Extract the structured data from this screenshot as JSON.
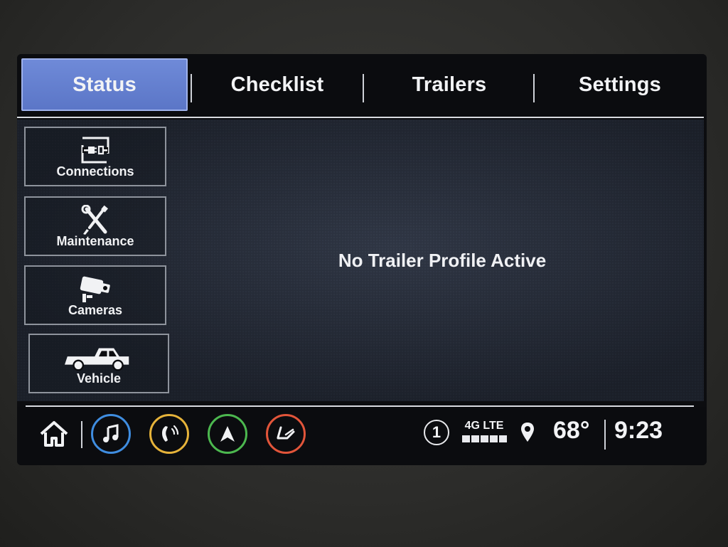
{
  "tabs": [
    {
      "label": "Status",
      "active": true
    },
    {
      "label": "Checklist",
      "active": false
    },
    {
      "label": "Trailers",
      "active": false
    },
    {
      "label": "Settings",
      "active": false
    }
  ],
  "sidebar": {
    "items": [
      {
        "label": "Connections",
        "icon": "trailer-connection-icon"
      },
      {
        "label": "Maintenance",
        "icon": "wrench-screwdriver-icon"
      },
      {
        "label": "Cameras",
        "icon": "camera-icon"
      },
      {
        "label": "Vehicle",
        "icon": "pickup-truck-icon"
      }
    ]
  },
  "main": {
    "message": "No Trailer Profile Active"
  },
  "bottombar": {
    "apps": [
      {
        "name": "music",
        "icon": "music-note-icon",
        "color": "#3f8de0"
      },
      {
        "name": "phone",
        "icon": "phone-icon",
        "color": "#e6b33a"
      },
      {
        "name": "navigation",
        "icon": "navigation-arrow-icon",
        "color": "#4cb84f"
      },
      {
        "name": "seat",
        "icon": "seat-icon",
        "color": "#e2553a"
      }
    ],
    "notification_count": "1",
    "network": "4G LTE",
    "signal_bars": 5,
    "temperature": "68°",
    "time": "9:23"
  },
  "colors": {
    "active_tab": "#6480cf",
    "background": "#232833"
  }
}
